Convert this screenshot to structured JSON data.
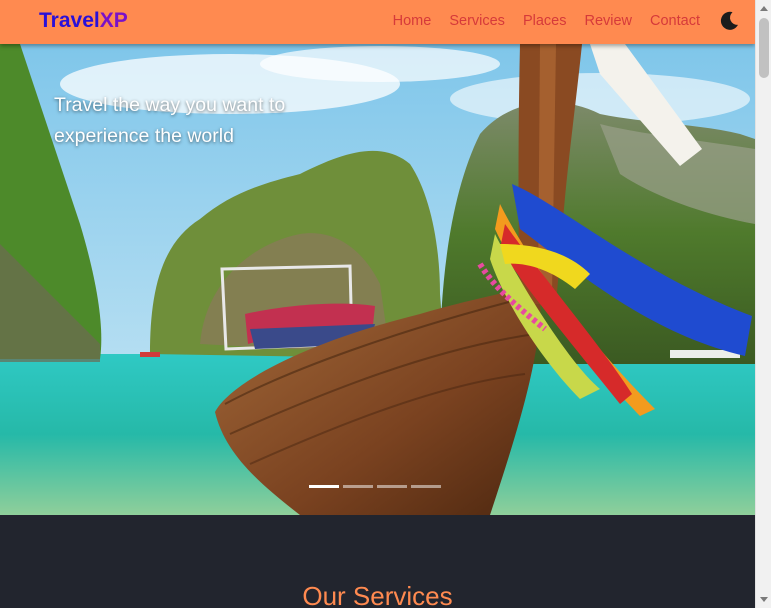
{
  "brand": {
    "part1": "Travel",
    "part2": "XP"
  },
  "nav": {
    "items": [
      {
        "label": "Home"
      },
      {
        "label": "Services"
      },
      {
        "label": "Places"
      },
      {
        "label": "Review"
      },
      {
        "label": "Contact"
      }
    ],
    "theme_toggle_icon": "moon-icon"
  },
  "hero": {
    "headline": "Travel the way you want to experience the world",
    "slides_count": 4,
    "active_slide": 1
  },
  "services": {
    "title": "Our Services"
  },
  "colors": {
    "navbar_bg": "#ff8a50",
    "nav_link": "#d63a3a",
    "brand_travel": "#2a10d8",
    "brand_xp": "#7a12c8",
    "section_dark": "#22252e",
    "section_title": "#ff8a50"
  }
}
